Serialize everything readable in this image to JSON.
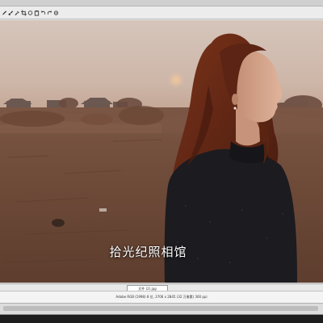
{
  "toolbar": {
    "icons": [
      "pencil-icon",
      "brush-icon",
      "dropper-icon",
      "crop-icon",
      "circle-icon",
      "paste-icon",
      "undo-icon",
      "redo-icon",
      "settings-icon"
    ]
  },
  "tabs": {
    "file_label": "文件 (2).jpg"
  },
  "canvas": {
    "caption": "拾光纪照相馆"
  },
  "status": {
    "text": "Adobe RGB (1998) 8 位, 3706 x 2845 (32 万像素) 300 ppi"
  },
  "colors": {
    "sky_top": "#d3c0b6",
    "sky_horizon": "#c9b1a2",
    "ground": "#6f4c3a",
    "hair": "#6b2a17",
    "sweater": "#1b1a1f",
    "window_chrome": "#e4e4e4"
  }
}
